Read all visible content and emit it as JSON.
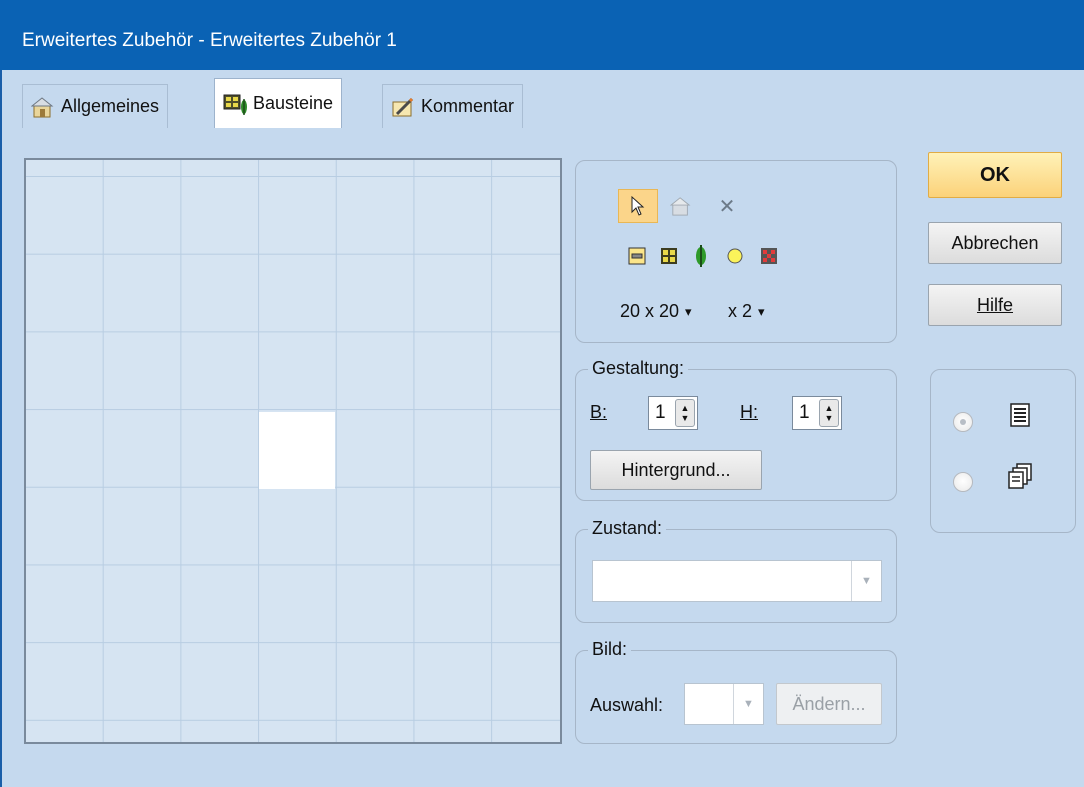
{
  "window": {
    "title": "Erweitertes Zubehör - Erweitertes Zubehör 1"
  },
  "tabs": [
    {
      "label": "Allgemeines",
      "icon": "properties-icon",
      "active": false
    },
    {
      "label": "Bausteine",
      "icon": "building-blocks-icon",
      "active": true
    },
    {
      "label": "Kommentar",
      "icon": "comment-icon",
      "active": false
    }
  ],
  "tools": {
    "row1": [
      "select-pointer-icon",
      "properties-icon",
      "delete-x-icon"
    ],
    "row2": [
      "rectangle-element-icon",
      "grid-element-icon",
      "signal-element-icon",
      "circle-led-icon",
      "matrix-element-icon"
    ],
    "grid_size": "20 x 20",
    "zoom": "x 2",
    "dropdown_glyph": "▾"
  },
  "gestaltung": {
    "legend": "Gestaltung:",
    "b_label": "B:",
    "b_value": "1",
    "h_label": "H:",
    "h_value": "1",
    "background_button": "Hintergrund..."
  },
  "zustand": {
    "legend": "Zustand:",
    "value": ""
  },
  "bild": {
    "legend": "Bild:",
    "auswahl_label": "Auswahl:",
    "change_button": "Ändern..."
  },
  "buttons": {
    "ok": "OK",
    "cancel": "Abbrechen",
    "help": "Hilfe"
  },
  "view_mode": {
    "options": [
      "single-page-icon",
      "multi-page-icon"
    ],
    "selected": 0
  },
  "colors": {
    "titlebar": "#0a62b4",
    "background": "#c5d9ee",
    "ok_button": "#fbd27a",
    "tool_selected": "#fbd58a"
  }
}
